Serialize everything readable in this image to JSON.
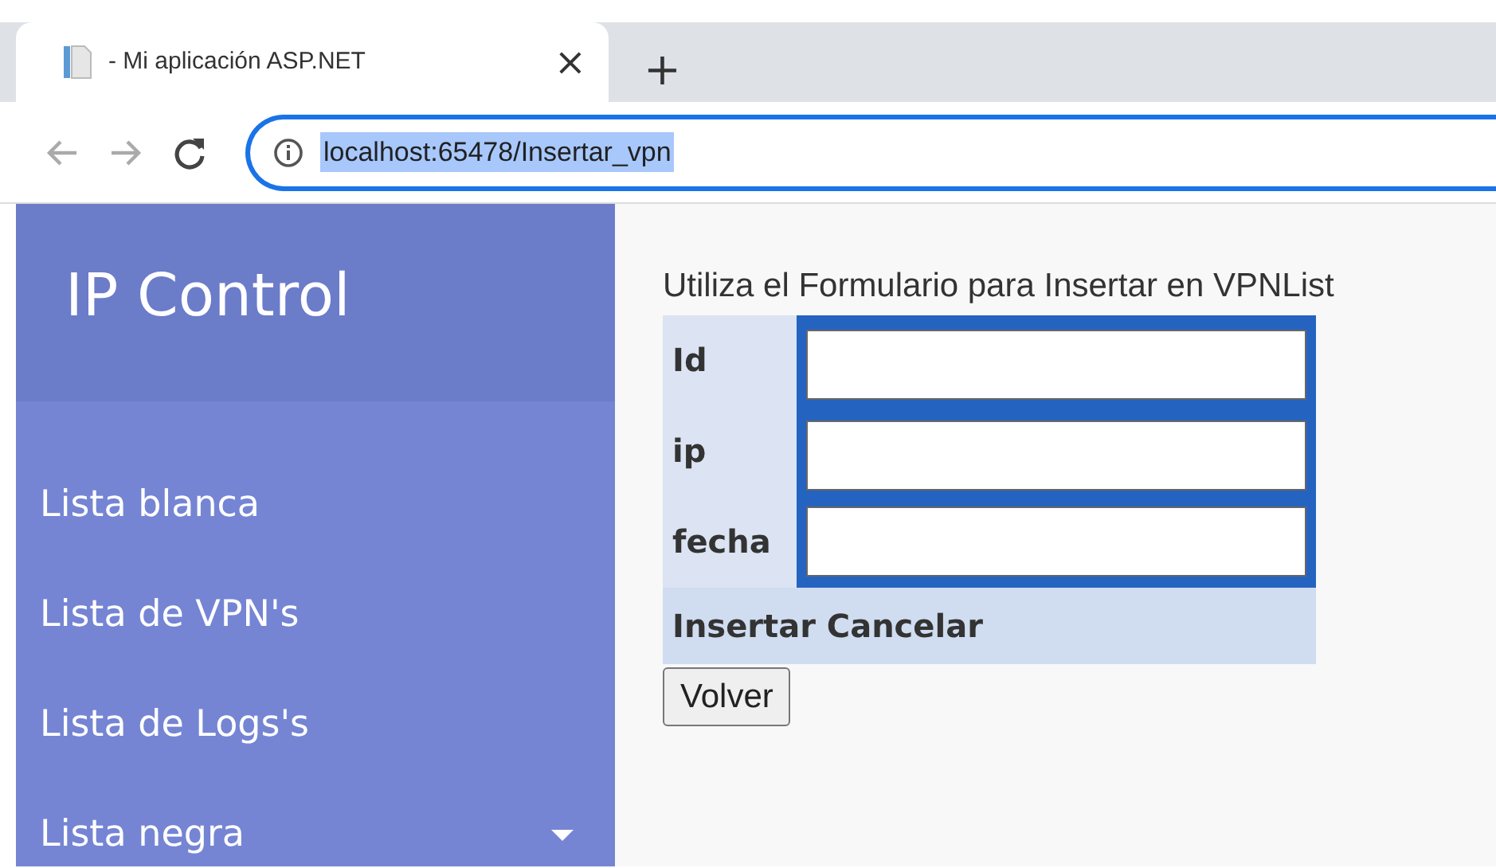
{
  "browser": {
    "tab": {
      "title": "- Mi aplicación ASP.NET",
      "close": "×",
      "new_tab": "+"
    },
    "url": {
      "text": "localhost:65478/Insertar_vpn",
      "highlighted": true
    }
  },
  "sidebar": {
    "brand": "IP Control",
    "items": [
      {
        "label": "Lista blanca",
        "kind": "link"
      },
      {
        "label": "Lista de VPN's",
        "kind": "link"
      },
      {
        "label": "Lista de Logs's",
        "kind": "link"
      },
      {
        "label": "Lista negra",
        "kind": "dropdown"
      }
    ]
  },
  "form": {
    "intro": "Utiliza el Formulario para Insertar en VPNList",
    "fields": [
      {
        "label": "Id"
      },
      {
        "label": "ip"
      },
      {
        "label": "fecha"
      }
    ],
    "actions": [
      "Insertar",
      "Cancelar"
    ],
    "back_button": "Volver"
  }
}
